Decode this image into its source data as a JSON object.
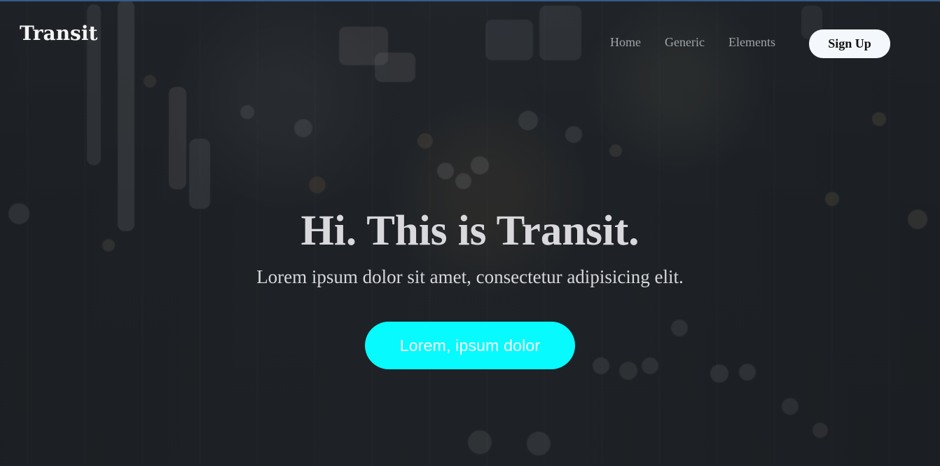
{
  "header": {
    "logo": "Transit",
    "nav": [
      "Home",
      "Generic",
      "Elements"
    ],
    "signup_label": "Sign Up"
  },
  "hero": {
    "title": "Hi. This is Transit.",
    "subtitle": "Lorem ipsum dolor sit amet, consectetur adipisicing elit.",
    "button_label": "Lorem, ipsum dolor"
  },
  "colors": {
    "accent": "#06fafe",
    "topline": "#355d8d",
    "signup_background": "#f4f7fb"
  }
}
